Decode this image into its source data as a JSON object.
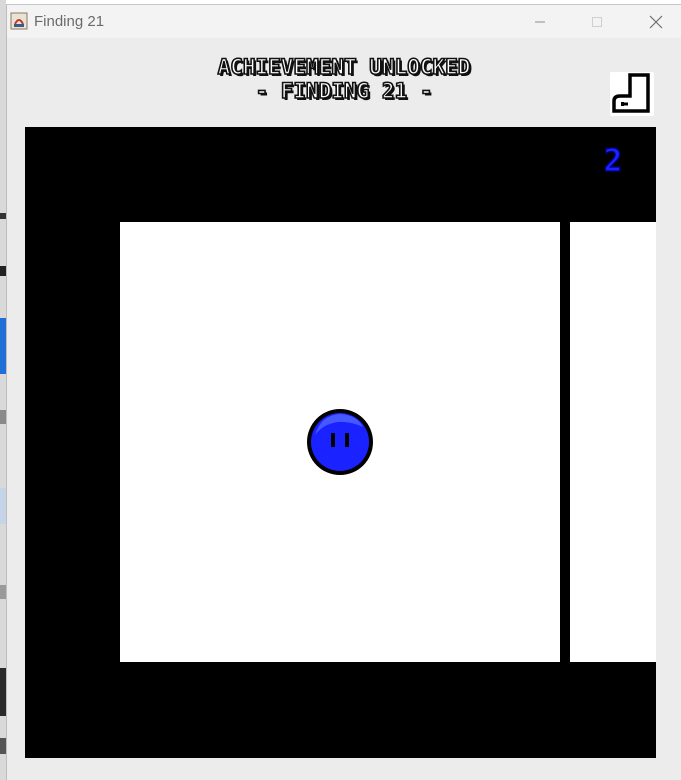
{
  "window": {
    "title": "Finding 21",
    "controls": [
      "minimize-icon",
      "maximize-icon",
      "close-icon"
    ]
  },
  "header": {
    "line1": "ACHIEVEMENT UNLOCKED",
    "line2": "- FINDING 21 -",
    "corner_icon": "boot-icon"
  },
  "game": {
    "counter": "2",
    "player_icon": "blue-blob-icon",
    "colors": {
      "background": "#000000",
      "room": "#ffffff",
      "player": "#1a22ff",
      "counter": "#1a22ff"
    }
  }
}
